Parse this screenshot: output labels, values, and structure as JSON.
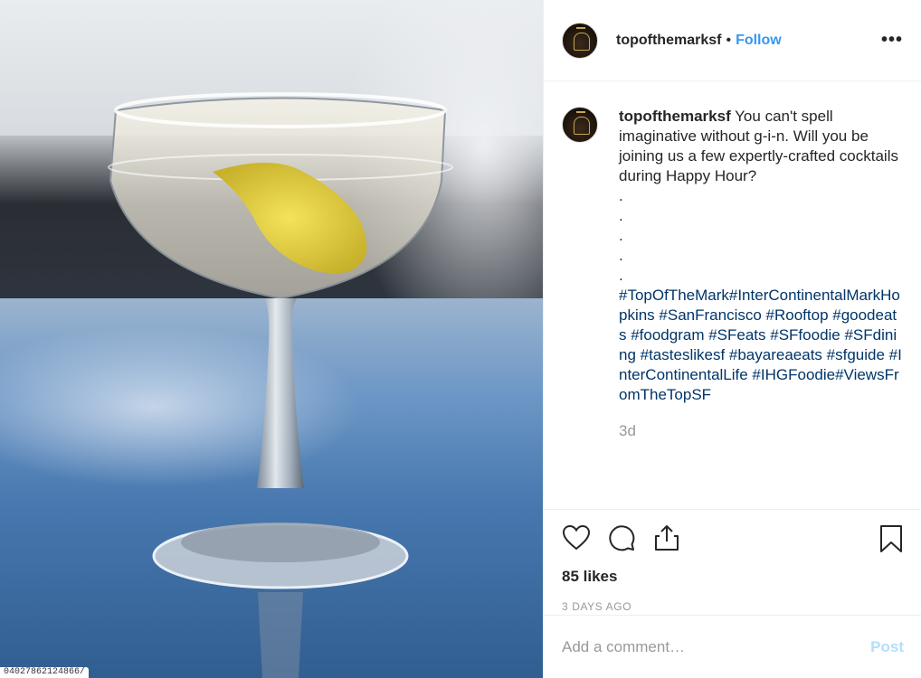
{
  "post": {
    "image_caption_tag": "04027862124866/"
  },
  "header": {
    "username": "topofthemarksf",
    "separator": "•",
    "follow_label": "Follow",
    "more_label": "•••",
    "avatar_icon": "hotel-logo-icon"
  },
  "caption": {
    "username": "topofthemarksf",
    "text": "You can't spell imaginative without g-i-n. Will you be joining us a few expertly-crafted cocktails during Happy Hour?",
    "dots": [
      ".",
      ".",
      ".",
      ".",
      "."
    ],
    "hashtags": "#TopOfTheMark#InterContinentalMarkHopkins #SanFrancisco #Rooftop #goodeats #foodgram #SFeats #SFfoodie #SFdining #tasteslikesf #bayareaeats #sfguide #InterContinentalLife #IHGFoodie#ViewsFromTheTopSF",
    "time": "3d"
  },
  "actions": {
    "icons": [
      "heart-icon",
      "comment-icon",
      "share-icon",
      "bookmark-icon"
    ],
    "likes": "85 likes",
    "time_ago": "3 DAYS AGO"
  },
  "comment_box": {
    "placeholder": "Add a comment…",
    "post_label": "Post"
  },
  "colors": {
    "link_blue": "#3897f0",
    "hashtag_blue": "#003569",
    "post_disabled": "#b2dffc",
    "muted": "#999999"
  }
}
